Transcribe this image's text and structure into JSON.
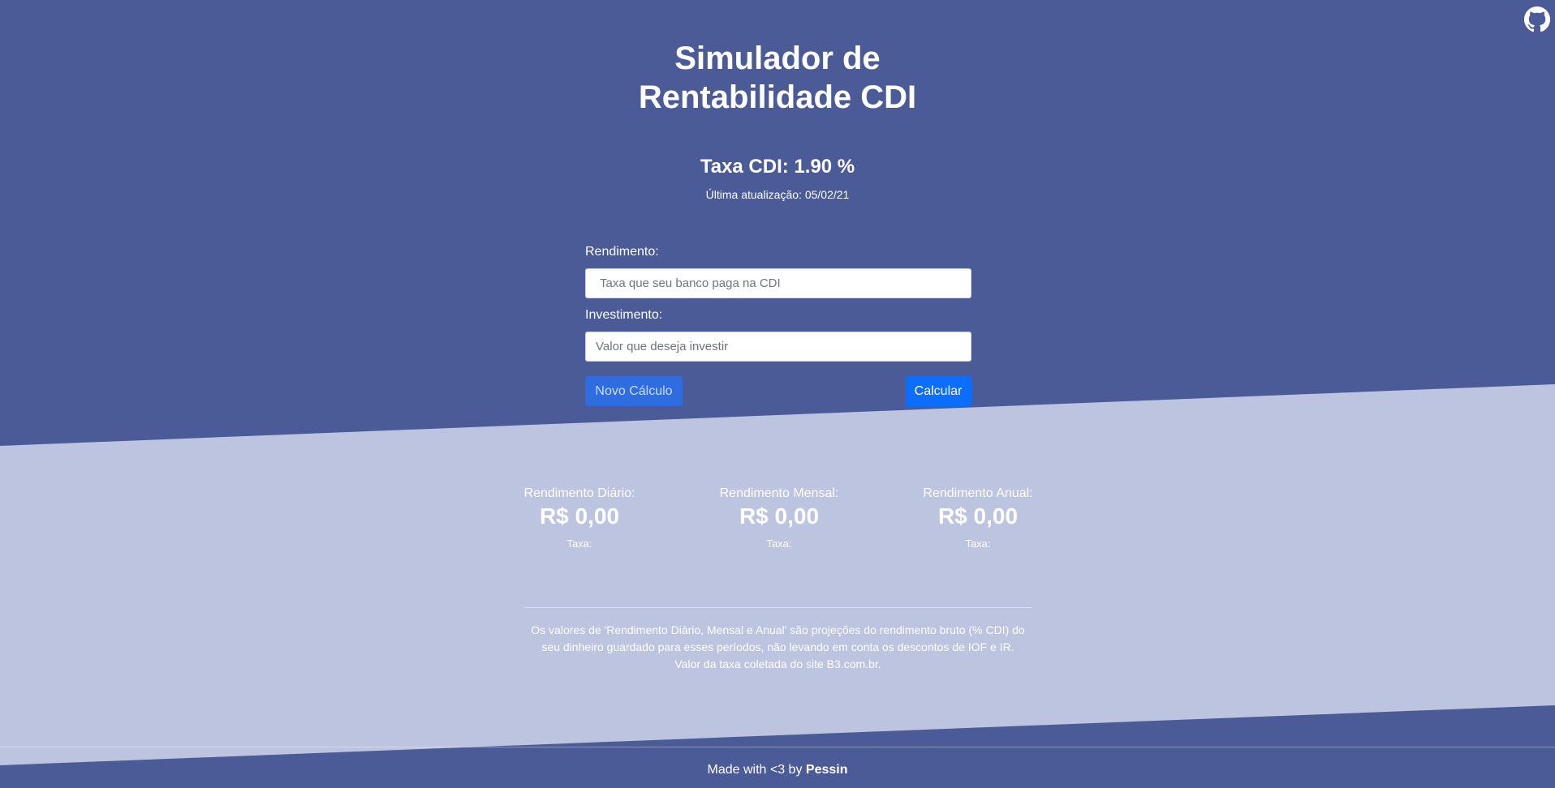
{
  "colors": {
    "primary_bg": "#4a5b97",
    "light_bg": "#bcc4df",
    "button_primary": "#0d6efd",
    "button_secondary": "#2e6de0",
    "text": "#ffffff"
  },
  "header": {
    "github_icon": "github-icon",
    "title_line1": "Simulador de",
    "title_line2": "Rentabilidade CDI"
  },
  "cdi": {
    "rate_text": "Taxa CDI: 1.90 %",
    "last_update": "Última atualização: 05/02/21"
  },
  "form": {
    "rendimento_label": "Rendimento:",
    "rendimento_placeholder": "Taxa que seu banco paga na CDI",
    "investimento_label": "Investimento:",
    "investimento_placeholder": "Valor que deseja investir",
    "novo_calculo_label": "Novo Cálculo",
    "calcular_label": "Calcular"
  },
  "results": [
    {
      "label": "Rendimento Diário:",
      "value": "R$ 0,00",
      "rate": "Taxa:"
    },
    {
      "label": "Rendimento Mensal:",
      "value": "R$ 0,00",
      "rate": "Taxa:"
    },
    {
      "label": "Rendimento Anual:",
      "value": "R$ 0,00",
      "rate": "Taxa:"
    }
  ],
  "disclaimer": {
    "line1": "Os valores de 'Rendimento Diário, Mensal e Anual' são projeções do rendimento bruto (% CDI) do",
    "line2": "seu dinheiro guardado para esses períodos, não levando em conta os descontos de IOF e IR.",
    "line3": "Valor da taxa coletada do site B3.com.br."
  },
  "footer": {
    "prefix": "Made with <3 by",
    "author": "Pessin"
  }
}
